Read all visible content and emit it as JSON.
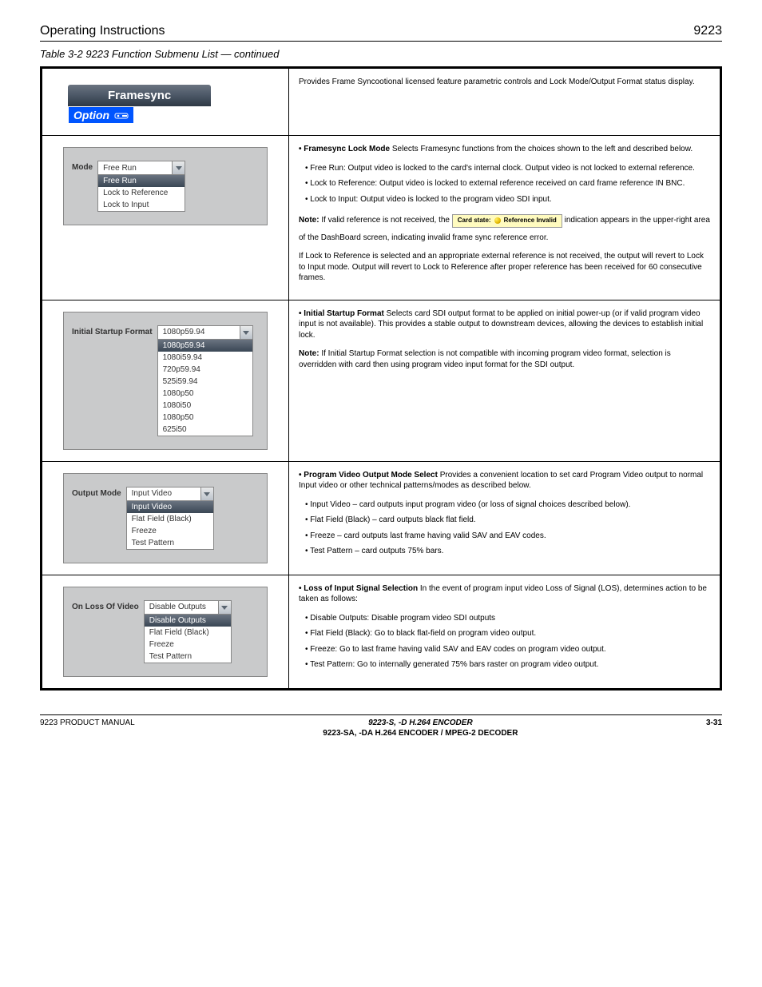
{
  "header": {
    "left": "Operating Instructions",
    "right": "9223"
  },
  "tableCaption": "Table 3-2  9223 Function Submenu List — continued",
  "banner": {
    "title": "Framesync",
    "optionLabel": "Option"
  },
  "bannerDesc": "Provides Frame Syncootional licensed feature parametric controls and Lock Mode/Output Format status display.",
  "rowMode": {
    "label": "Mode",
    "selected": "Free Run",
    "options": [
      "Free Run",
      "Lock to Reference",
      "Lock to Input"
    ],
    "heading": "• Framesync Lock Mode",
    "desc": "Selects Framesync functions from the choices shown to the left and described below.",
    "b1": "• Free Run: Output video is locked to the card's internal clock. Output video is not locked to external reference.",
    "b2": "• Lock to Reference: Output video is locked to external reference received on card frame reference IN BNC.",
    "b3": "• Lock to Input: Output video is locked to the program video SDI input.",
    "noteLead": "Note:",
    "note": " If valid reference is not received, the ",
    "noteMid": " indication appears in the upper-right area of the DashBoard screen, indicating invalid frame sync reference error.",
    "cardStateLabel": "Card state:",
    "cardStateValue": "Reference Invalid",
    "note2": "If Lock to Reference is selected and an appropriate external reference is not received, the output will revert to Lock to Input mode. Output will revert to Lock to Reference after proper reference has been received for 60 consecutive frames."
  },
  "rowStartup": {
    "label": "Initial Startup Format",
    "selected": "1080p59.94",
    "options": [
      "1080p59.94",
      "1080i59.94",
      "720p59.94",
      "525i59.94",
      "1080p50",
      "1080i50",
      "1080p50",
      "625i50"
    ],
    "heading": "• Initial Startup Format",
    "desc": "Selects card SDI output format to be applied on initial power-up (or if valid program video input is not available). This provides a stable output to downstream devices, allowing the devices to establish initial lock.",
    "noteLead": "Note:",
    "note": " If Initial Startup Format selection is not compatible with incoming program video format, selection is overridden with card then using program video input format for the SDI output."
  },
  "rowOutput": {
    "label": "Output Mode",
    "selected": "Input Video",
    "options": [
      "Input Video",
      "Flat Field (Black)",
      "Freeze",
      "Test Pattern"
    ],
    "heading": "• Program Video Output Mode Select",
    "desc": "Provides a convenient location to set card Program Video output to normal Input video or other technical patterns/modes as described below.",
    "b1": "• Input Video – card outputs input program video (or loss of signal choices described below).",
    "b2": "• Flat Field (Black) – card outputs black flat field.",
    "b3": "• Freeze – card outputs last frame having valid SAV and EAV codes.",
    "b4": "• Test Pattern – card outputs 75% bars."
  },
  "rowLoss": {
    "label": "On Loss Of Video",
    "selected": "Disable Outputs",
    "options": [
      "Disable Outputs",
      "Flat Field (Black)",
      "Freeze",
      "Test Pattern"
    ],
    "heading": "• Loss of Input Signal Selection",
    "desc": "In the event of program input video Loss of Signal (LOS), determines action to be taken as follows:",
    "b1": "• Disable Outputs: Disable program video SDI outputs",
    "b2": "• Flat Field (Black): Go to black flat-field on program video output.",
    "b3": "• Freeze: Go to last frame having valid SAV and EAV codes on program video output.",
    "b4": "• Test Pattern: Go to internally generated 75% bars raster on program video output."
  },
  "footer": {
    "left": "9223 PRODUCT MANUAL",
    "center1": "9223-S, -D H.264 ENCODER",
    "center2": "9223-SA, -DA H.264 ENCODER / MPEG-2 DECODER",
    "right": "3-31"
  }
}
